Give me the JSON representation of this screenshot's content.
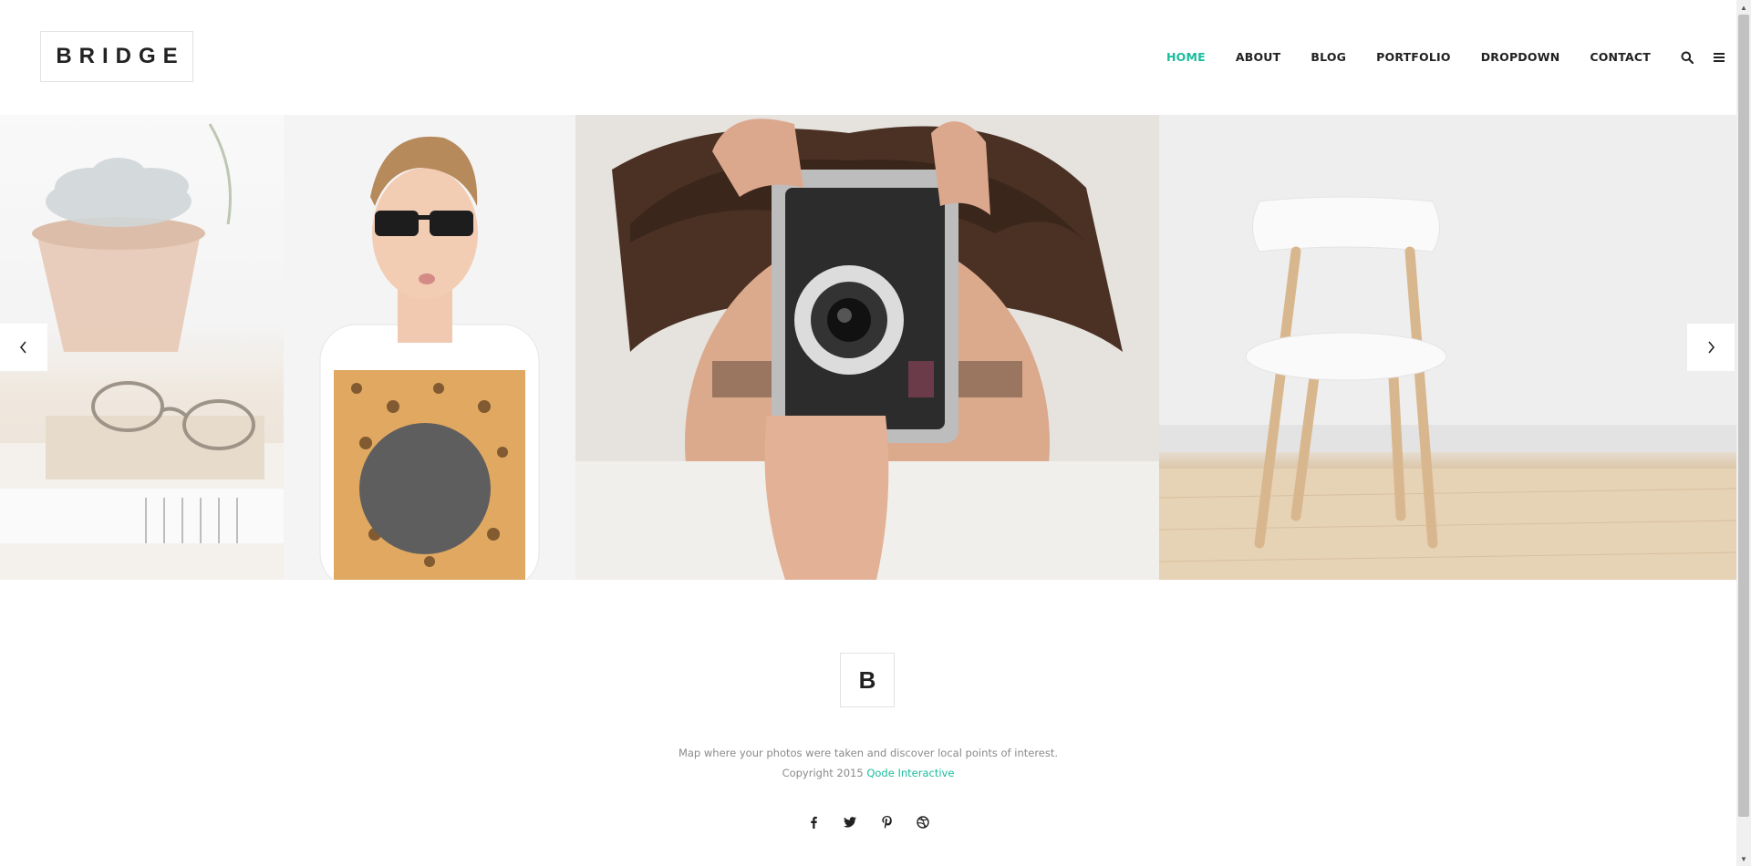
{
  "theme": {
    "accent": "#1abc9c",
    "text": "#222222",
    "muted": "#8a8a8a"
  },
  "header": {
    "logo": "BRIDGE",
    "nav": [
      {
        "label": "HOME",
        "active": true
      },
      {
        "label": "ABOUT"
      },
      {
        "label": "BLOG"
      },
      {
        "label": "PORTFOLIO"
      },
      {
        "label": "DROPDOWN"
      },
      {
        "label": "CONTACT"
      }
    ],
    "icons": [
      "search-icon",
      "menu-icon"
    ]
  },
  "slider": {
    "slides": [
      {
        "subject": "succulent, glasses and notebooks"
      },
      {
        "subject": "man in sunglasses and leopard t-shirt"
      },
      {
        "subject": "man holding vintage camera"
      },
      {
        "subject": "white chair on wooden floor"
      }
    ],
    "prev_icon": "chevron-left-icon",
    "next_icon": "chevron-right-icon"
  },
  "footer": {
    "logo": "B",
    "tagline": "Map where your photos were taken and discover local points of interest.",
    "copyright_prefix": "Copyright 2015",
    "copyright_link": "Qode Interactive",
    "social": [
      {
        "icon": "facebook-icon",
        "glyph": "f"
      },
      {
        "icon": "twitter-icon",
        "glyph": "t"
      },
      {
        "icon": "pinterest-icon",
        "glyph": "p"
      },
      {
        "icon": "dribbble-icon",
        "glyph": "◎"
      }
    ]
  }
}
